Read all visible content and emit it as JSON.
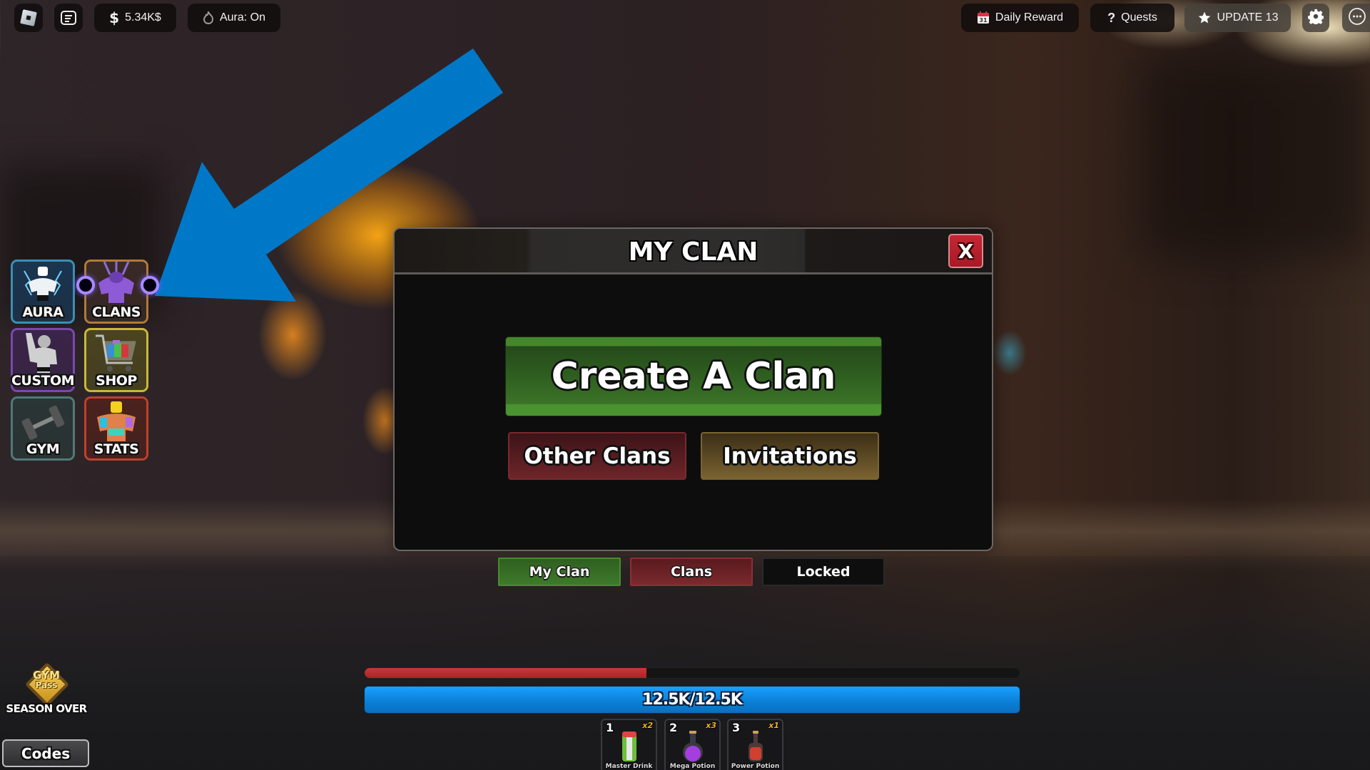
{
  "topbar": {
    "left": {
      "roblox_menu_icon": "roblox-logo-icon",
      "chat_icon": "chat-icon",
      "currency": {
        "icon": "dollar-icon",
        "symbol": "$",
        "value": "5.34K$"
      },
      "aura": {
        "icon": "aura-flame-icon",
        "label": "Aura: On"
      }
    },
    "right": {
      "daily_reward": {
        "icon": "calendar-icon",
        "calendar_day": "31",
        "label": "Daily Reward"
      },
      "quests": {
        "icon": "question-icon",
        "glyph": "?",
        "label": "Quests"
      },
      "update": {
        "icon": "star-icon",
        "label": "UPDATE 13"
      },
      "settings_icon": "gear-icon",
      "more_icon": "more-options-icon"
    }
  },
  "side_menu": {
    "items": [
      {
        "id": "aura",
        "label": "AURA",
        "icon": "aura-muscle-icon",
        "border": "#3a8fb5",
        "bg": "#1b3550"
      },
      {
        "id": "clans",
        "label": "CLANS",
        "icon": "clans-purple-muscle-icon",
        "border": "#b07a38",
        "bg": "#3a2a26"
      },
      {
        "id": "custom",
        "label": "CUSTOM",
        "icon": "custom-bodybuilder-icon",
        "border": "#7a48b0",
        "bg": "#3a2448"
      },
      {
        "id": "shop",
        "label": "SHOP",
        "icon": "shopping-cart-icon",
        "border": "#c9b83a",
        "bg": "#4a4420"
      },
      {
        "id": "gym",
        "label": "GYM",
        "icon": "dumbbell-icon",
        "border": "#4f7a78",
        "bg": "#2a3535"
      },
      {
        "id": "stats",
        "label": "STATS",
        "icon": "stats-muscle-icon",
        "border": "#c0402a",
        "bg": "#4a221e"
      }
    ]
  },
  "annotation": {
    "arrow_color": "#0078C8",
    "points_to": "clans"
  },
  "dialog": {
    "title": "MY CLAN",
    "close_label": "X",
    "create_label": "Create A Clan",
    "other_clans_label": "Other Clans",
    "invitations_label": "Invitations"
  },
  "tabs": [
    {
      "label": "My Clan",
      "active": true,
      "color": "#3e7a2a"
    },
    {
      "label": "Clans",
      "active": false,
      "color": "#7a2a2e"
    },
    {
      "label": "Locked",
      "active": false,
      "color": "#0e0e0e"
    }
  ],
  "bars": {
    "stamina_fraction": 0.43,
    "health_text": "12.5K/12.5K",
    "health_fraction": 1.0
  },
  "hotbar": [
    {
      "slot": "1",
      "qty": "x2",
      "name": "Master Drink",
      "icon": "energy-drink-can-icon"
    },
    {
      "slot": "2",
      "qty": "x3",
      "name": "Mega Potion",
      "icon": "purple-potion-icon"
    },
    {
      "slot": "3",
      "qty": "x1",
      "name": "Power Potion",
      "icon": "red-potion-icon"
    }
  ],
  "bottom_left": {
    "gym_pass": {
      "line1": "GYM",
      "line2": "Pass",
      "status": "SEASON OVER"
    },
    "codes_label": "Codes"
  }
}
